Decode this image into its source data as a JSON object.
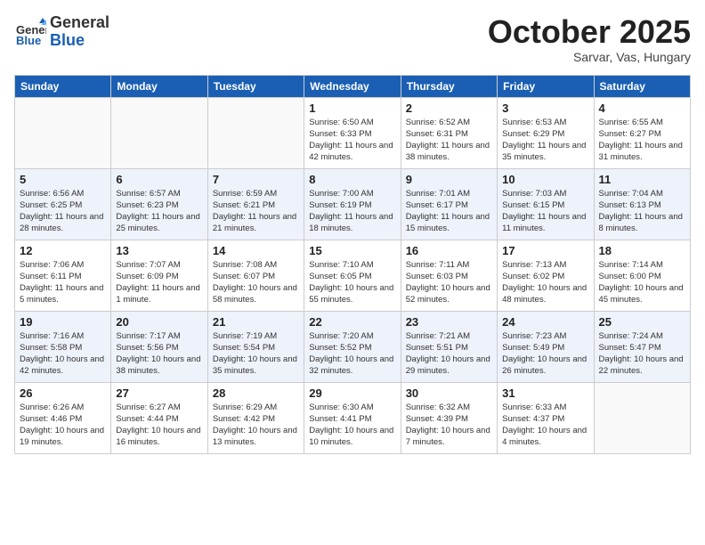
{
  "header": {
    "logo_general": "General",
    "logo_blue": "Blue",
    "month_title": "October 2025",
    "subtitle": "Sarvar, Vas, Hungary"
  },
  "days_of_week": [
    "Sunday",
    "Monday",
    "Tuesday",
    "Wednesday",
    "Thursday",
    "Friday",
    "Saturday"
  ],
  "weeks": [
    [
      {
        "day": "",
        "info": ""
      },
      {
        "day": "",
        "info": ""
      },
      {
        "day": "",
        "info": ""
      },
      {
        "day": "1",
        "info": "Sunrise: 6:50 AM\nSunset: 6:33 PM\nDaylight: 11 hours and 42 minutes."
      },
      {
        "day": "2",
        "info": "Sunrise: 6:52 AM\nSunset: 6:31 PM\nDaylight: 11 hours and 38 minutes."
      },
      {
        "day": "3",
        "info": "Sunrise: 6:53 AM\nSunset: 6:29 PM\nDaylight: 11 hours and 35 minutes."
      },
      {
        "day": "4",
        "info": "Sunrise: 6:55 AM\nSunset: 6:27 PM\nDaylight: 11 hours and 31 minutes."
      }
    ],
    [
      {
        "day": "5",
        "info": "Sunrise: 6:56 AM\nSunset: 6:25 PM\nDaylight: 11 hours and 28 minutes."
      },
      {
        "day": "6",
        "info": "Sunrise: 6:57 AM\nSunset: 6:23 PM\nDaylight: 11 hours and 25 minutes."
      },
      {
        "day": "7",
        "info": "Sunrise: 6:59 AM\nSunset: 6:21 PM\nDaylight: 11 hours and 21 minutes."
      },
      {
        "day": "8",
        "info": "Sunrise: 7:00 AM\nSunset: 6:19 PM\nDaylight: 11 hours and 18 minutes."
      },
      {
        "day": "9",
        "info": "Sunrise: 7:01 AM\nSunset: 6:17 PM\nDaylight: 11 hours and 15 minutes."
      },
      {
        "day": "10",
        "info": "Sunrise: 7:03 AM\nSunset: 6:15 PM\nDaylight: 11 hours and 11 minutes."
      },
      {
        "day": "11",
        "info": "Sunrise: 7:04 AM\nSunset: 6:13 PM\nDaylight: 11 hours and 8 minutes."
      }
    ],
    [
      {
        "day": "12",
        "info": "Sunrise: 7:06 AM\nSunset: 6:11 PM\nDaylight: 11 hours and 5 minutes."
      },
      {
        "day": "13",
        "info": "Sunrise: 7:07 AM\nSunset: 6:09 PM\nDaylight: 11 hours and 1 minute."
      },
      {
        "day": "14",
        "info": "Sunrise: 7:08 AM\nSunset: 6:07 PM\nDaylight: 10 hours and 58 minutes."
      },
      {
        "day": "15",
        "info": "Sunrise: 7:10 AM\nSunset: 6:05 PM\nDaylight: 10 hours and 55 minutes."
      },
      {
        "day": "16",
        "info": "Sunrise: 7:11 AM\nSunset: 6:03 PM\nDaylight: 10 hours and 52 minutes."
      },
      {
        "day": "17",
        "info": "Sunrise: 7:13 AM\nSunset: 6:02 PM\nDaylight: 10 hours and 48 minutes."
      },
      {
        "day": "18",
        "info": "Sunrise: 7:14 AM\nSunset: 6:00 PM\nDaylight: 10 hours and 45 minutes."
      }
    ],
    [
      {
        "day": "19",
        "info": "Sunrise: 7:16 AM\nSunset: 5:58 PM\nDaylight: 10 hours and 42 minutes."
      },
      {
        "day": "20",
        "info": "Sunrise: 7:17 AM\nSunset: 5:56 PM\nDaylight: 10 hours and 38 minutes."
      },
      {
        "day": "21",
        "info": "Sunrise: 7:19 AM\nSunset: 5:54 PM\nDaylight: 10 hours and 35 minutes."
      },
      {
        "day": "22",
        "info": "Sunrise: 7:20 AM\nSunset: 5:52 PM\nDaylight: 10 hours and 32 minutes."
      },
      {
        "day": "23",
        "info": "Sunrise: 7:21 AM\nSunset: 5:51 PM\nDaylight: 10 hours and 29 minutes."
      },
      {
        "day": "24",
        "info": "Sunrise: 7:23 AM\nSunset: 5:49 PM\nDaylight: 10 hours and 26 minutes."
      },
      {
        "day": "25",
        "info": "Sunrise: 7:24 AM\nSunset: 5:47 PM\nDaylight: 10 hours and 22 minutes."
      }
    ],
    [
      {
        "day": "26",
        "info": "Sunrise: 6:26 AM\nSunset: 4:46 PM\nDaylight: 10 hours and 19 minutes."
      },
      {
        "day": "27",
        "info": "Sunrise: 6:27 AM\nSunset: 4:44 PM\nDaylight: 10 hours and 16 minutes."
      },
      {
        "day": "28",
        "info": "Sunrise: 6:29 AM\nSunset: 4:42 PM\nDaylight: 10 hours and 13 minutes."
      },
      {
        "day": "29",
        "info": "Sunrise: 6:30 AM\nSunset: 4:41 PM\nDaylight: 10 hours and 10 minutes."
      },
      {
        "day": "30",
        "info": "Sunrise: 6:32 AM\nSunset: 4:39 PM\nDaylight: 10 hours and 7 minutes."
      },
      {
        "day": "31",
        "info": "Sunrise: 6:33 AM\nSunset: 4:37 PM\nDaylight: 10 hours and 4 minutes."
      },
      {
        "day": "",
        "info": ""
      }
    ]
  ]
}
